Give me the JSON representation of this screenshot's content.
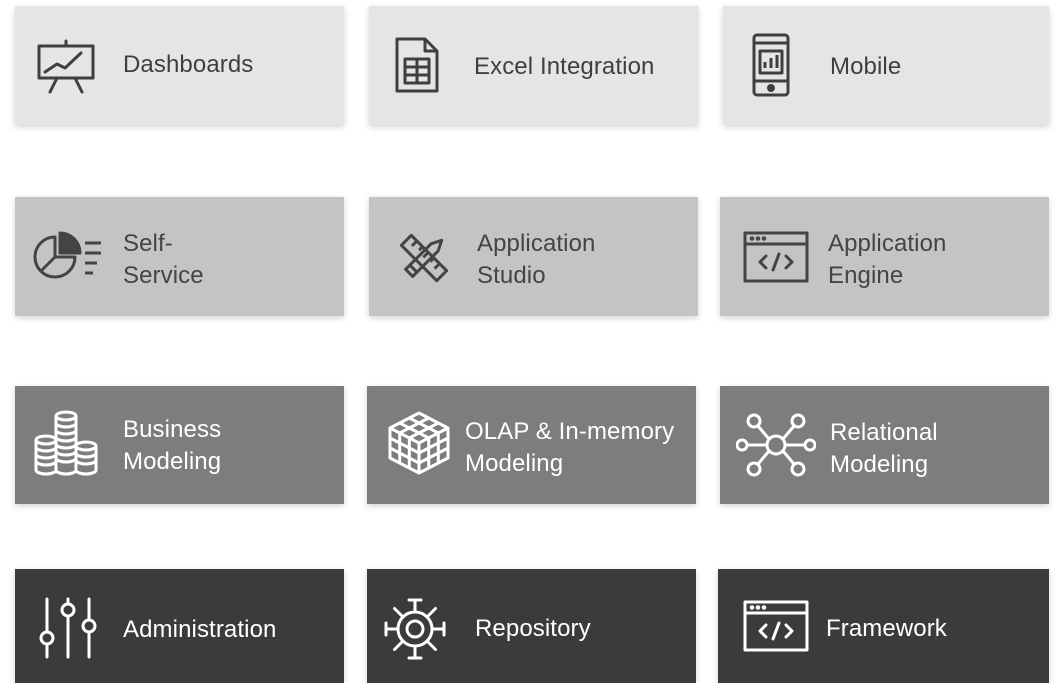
{
  "colors": {
    "row1_bg": "#e5e5e5",
    "row2_bg": "#c4c4c4",
    "row3_bg": "#7d7d7d",
    "row4_bg": "#3b3b3b",
    "dark_icon": "#3f3f3f",
    "light_icon": "#ffffff"
  },
  "tiles": {
    "dashboards": {
      "label": "Dashboards",
      "icon": "presentation-chart-icon"
    },
    "excel": {
      "label": "Excel Integration",
      "icon": "spreadsheet-icon"
    },
    "mobile": {
      "label": "Mobile",
      "icon": "mobile-chart-icon"
    },
    "self_service": {
      "line1": "Self-",
      "line2": "Service",
      "icon": "pie-list-icon"
    },
    "app_studio": {
      "line1": "Application",
      "line2": "Studio",
      "icon": "ruler-pencil-icon"
    },
    "app_engine": {
      "line1": "Application",
      "line2": "Engine",
      "icon": "code-window-icon"
    },
    "business_modeling": {
      "line1": "Business",
      "line2": "Modeling",
      "icon": "coin-stacks-icon"
    },
    "olap": {
      "line1": "OLAP & In-memory",
      "line2": "Modeling",
      "icon": "cube-icon"
    },
    "relational": {
      "line1": "Relational",
      "line2": "Modeling",
      "icon": "network-nodes-icon"
    },
    "administration": {
      "label": "Administration",
      "icon": "sliders-icon"
    },
    "repository": {
      "label": "Repository",
      "icon": "gear-icon"
    },
    "framework": {
      "label": "Framework",
      "icon": "code-window-icon"
    }
  }
}
